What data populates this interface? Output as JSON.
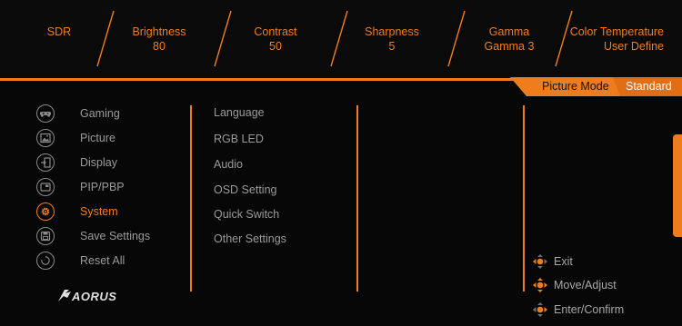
{
  "status_bar": {
    "sdr": "SDR",
    "brightness": {
      "label": "Brightness",
      "value": "80"
    },
    "contrast": {
      "label": "Contrast",
      "value": "50"
    },
    "sharpness": {
      "label": "Sharpness",
      "value": "5"
    },
    "gamma": {
      "label": "Gamma",
      "value": "Gamma 3"
    },
    "color_temperature": {
      "label": "Color Temperature",
      "value": "User Define"
    }
  },
  "picture_mode": {
    "label": "Picture Mode",
    "value": "Standard"
  },
  "menu": {
    "items": [
      {
        "label": "Gaming",
        "icon": "gamepad-icon"
      },
      {
        "label": "Picture",
        "icon": "picture-icon"
      },
      {
        "label": "Display",
        "icon": "display-input-icon"
      },
      {
        "label": "PIP/PBP",
        "icon": "pip-icon"
      },
      {
        "label": "System",
        "icon": "gear-icon",
        "active": true
      },
      {
        "label": "Save Settings",
        "icon": "save-icon"
      },
      {
        "label": "Reset All",
        "icon": "reset-icon"
      }
    ]
  },
  "submenu": {
    "items": [
      "Language",
      "RGB LED",
      "Audio",
      "OSD Setting",
      "Quick Switch",
      "Other Settings"
    ]
  },
  "hints": {
    "exit": "Exit",
    "move": "Move/Adjust",
    "enter": "Enter/Confirm"
  },
  "colors": {
    "accent": "#f07d1c",
    "text": "#9a9a9a",
    "background": "#070707"
  }
}
